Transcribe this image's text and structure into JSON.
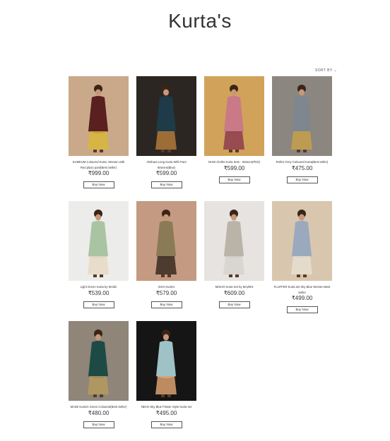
{
  "page": {
    "title": "Kurta's",
    "sort_label": "SORT BY"
  },
  "products": [
    {
      "name": "KUMKUM Coloured Kurta- Women with Red plazo pant(Best Seller)",
      "price": "₹999.00",
      "button": "Buy Now",
      "colors": {
        "bg": "#c9a98a",
        "body": "#5a1f1f",
        "accent": "#d8b73a"
      }
    },
    {
      "name": "Akshara Long Kurta With Pant Women(Blue)",
      "price": "₹599.00",
      "button": "Buy Now",
      "colors": {
        "bg": "#2b2622",
        "body": "#1f3a48",
        "accent": "#b07a3a"
      }
    },
    {
      "name": "DUNI Cloths Kurta Sets - Women(Pink)",
      "price": "₹599.00",
      "button": "Buy Now",
      "colors": {
        "bg": "#d1a35a",
        "body": "#c97a86",
        "accent": "#8e3d4d"
      }
    },
    {
      "name": "Rohini Grey Coloured Kurta(Best seller)",
      "price": "₹475.00",
      "button": "Buy Now",
      "colors": {
        "bg": "#8b8680",
        "body": "#7e8690",
        "accent": "#c6a04a"
      }
    },
    {
      "name": "Light Green Kurta by MAZE",
      "price": "₹539.00",
      "button": "Buy Now",
      "colors": {
        "bg": "#ececea",
        "body": "#a9c4a2",
        "accent": "#e8d9c4"
      }
    },
    {
      "name": "ISHA Kurta's",
      "price": "₹579.00",
      "button": "Buy Now",
      "colors": {
        "bg": "#c49a82",
        "body": "#8a7a55",
        "accent": "#3a2a22"
      }
    },
    {
      "name": "MISHO Kurta Set by MAZEN",
      "price": "₹609.00",
      "button": "Buy Now",
      "colors": {
        "bg": "#e6e3e0",
        "body": "#b9b3a8",
        "accent": "#d6d2ce"
      }
    },
    {
      "name": "FLUFFER Kurta set Sky Blue Women-Best Seller",
      "price": "₹499.00",
      "button": "Buy Now",
      "colors": {
        "bg": "#d8c7ae",
        "body": "#9aa9bd",
        "accent": "#e8ded0"
      }
    },
    {
      "name": "MAZE Kurta's Green Coloured(Best Seller)",
      "price": "₹480.00",
      "button": "Buy Now",
      "colors": {
        "bg": "#8f8579",
        "body": "#1e4a45",
        "accent": "#b59a5e"
      }
    },
    {
      "name": "NEHA Sky Blue Flower Style Kurta set",
      "price": "₹495.00",
      "button": "Buy Now",
      "colors": {
        "bg": "#151515",
        "body": "#9ec2c6",
        "accent": "#d9a070"
      }
    }
  ]
}
